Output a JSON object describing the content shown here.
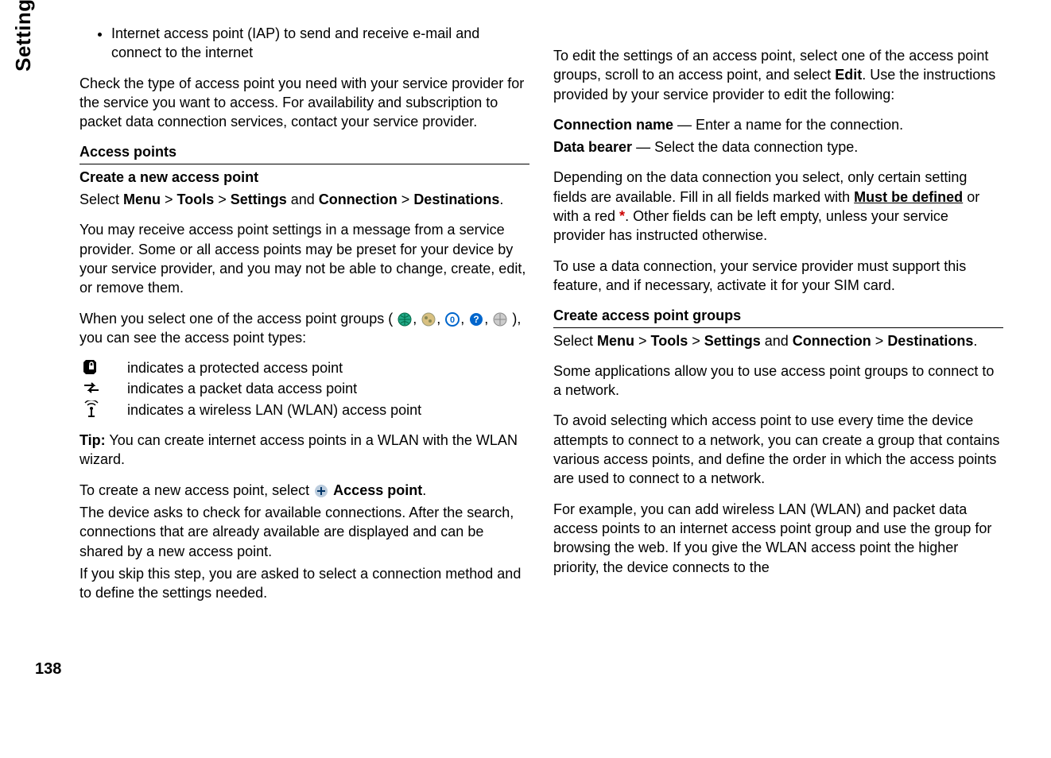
{
  "side_label": "Settings",
  "page_number": "138",
  "col1": {
    "bullet1": "Internet access point (IAP) to send and receive e-mail and connect to the internet",
    "p1": "Check the type of access point you need with your service provider for the service you want to access. For availability and subscription to packet data connection services, contact your service provider.",
    "h1": "Access points",
    "h2": "Create a new access point",
    "nav_pre": "Select ",
    "nav_menu": "Menu",
    "nav_sep": " > ",
    "nav_tools": "Tools",
    "nav_settings": "Settings",
    "nav_and": " and ",
    "nav_conn": "Connection",
    "nav_dest": "Destinations",
    "nav_end": ".",
    "p2": "You may receive access point settings in a message from a service provider. Some or all access points may be preset for your device by your service provider, and you may not be able to change, create, edit, or remove them.",
    "p3a": "When you select one of the access point groups (",
    "p3b": "), you can see the access point types:",
    "row1": "indicates a protected access point",
    "row2": "indicates a packet data access point",
    "row3": "indicates a wireless LAN (WLAN) access point",
    "tip_label": "Tip:",
    "tip_text": " You can create internet access points in a WLAN with the WLAN wizard.",
    "p4a": "To create a new access point, select ",
    "p4b": "Access point",
    "p4c": ".",
    "p5": "The device asks to check for available connections. After the search, connections that are already available are displayed and can be shared by a new access point.",
    "p6": "If you skip this step, you are asked to select a connection method and to define the settings needed."
  },
  "col2": {
    "p1a": "To edit the settings of an access point, select one of the access point groups, scroll to an access point, and select ",
    "p1b": "Edit",
    "p1c": ". Use the instructions provided by your service provider to edit the following:",
    "conn_name_label": "Connection name",
    "conn_name_text": "  — Enter a name for the connection.",
    "data_bearer_label": "Data bearer",
    "data_bearer_text": "  — Select the data connection type.",
    "p2a": "Depending on the data connection you select, only certain setting fields are available. Fill in all fields marked with ",
    "p2b": "Must be defined",
    "p2c": " or with a red ",
    "p2d": "*",
    "p2e": ". Other fields can be left empty, unless your service provider has instructed otherwise.",
    "p3": "To use a data connection, your service provider must support this feature, and if necessary, activate it for your SIM card.",
    "h1": "Create access point groups",
    "p4": "Some applications allow you to use access point groups to connect to a network.",
    "p5": "To avoid selecting which access point to use every time the device attempts to connect to a network, you can create a group that contains various access points, and define the order in which the access points are used to connect to a network.",
    "p6": "For example, you can add wireless LAN (WLAN) and packet data access points to an internet access point group and use the group for browsing the web. If you give the WLAN access point the higher priority, the device connects to the"
  }
}
